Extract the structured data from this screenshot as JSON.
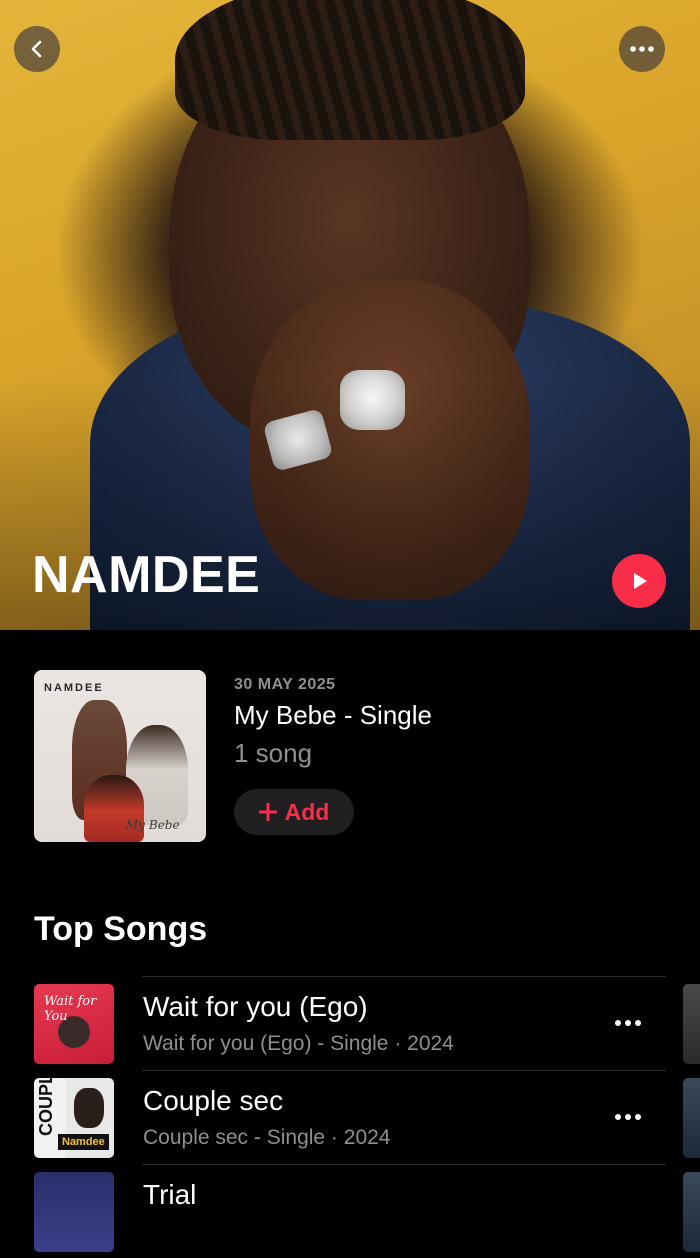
{
  "artist": {
    "name": "NAMDEE"
  },
  "header": {
    "back_icon": "chevron-left-icon",
    "more_icon": "ellipsis-icon"
  },
  "latest_release": {
    "date": "30 MAY 2025",
    "title": "My Bebe - Single",
    "song_count": "1 song",
    "add_label": "Add",
    "art_label": "NAMDEE",
    "art_signature": "My Bebe"
  },
  "top_songs": {
    "title": "Top Songs",
    "items": [
      {
        "title": "Wait for you (Ego)",
        "subtitle": "Wait for you (Ego) - Single · 2024",
        "art_text": "Wait for You"
      },
      {
        "title": "Couple sec",
        "subtitle": "Couple sec - Single · 2024",
        "art_text": "COUPLE",
        "art_name": "Namdee"
      },
      {
        "title": "Trial",
        "subtitle": ""
      }
    ]
  },
  "colors": {
    "accent": "#fa2d48",
    "background": "#000000",
    "secondary_text": "#8e8e93"
  }
}
